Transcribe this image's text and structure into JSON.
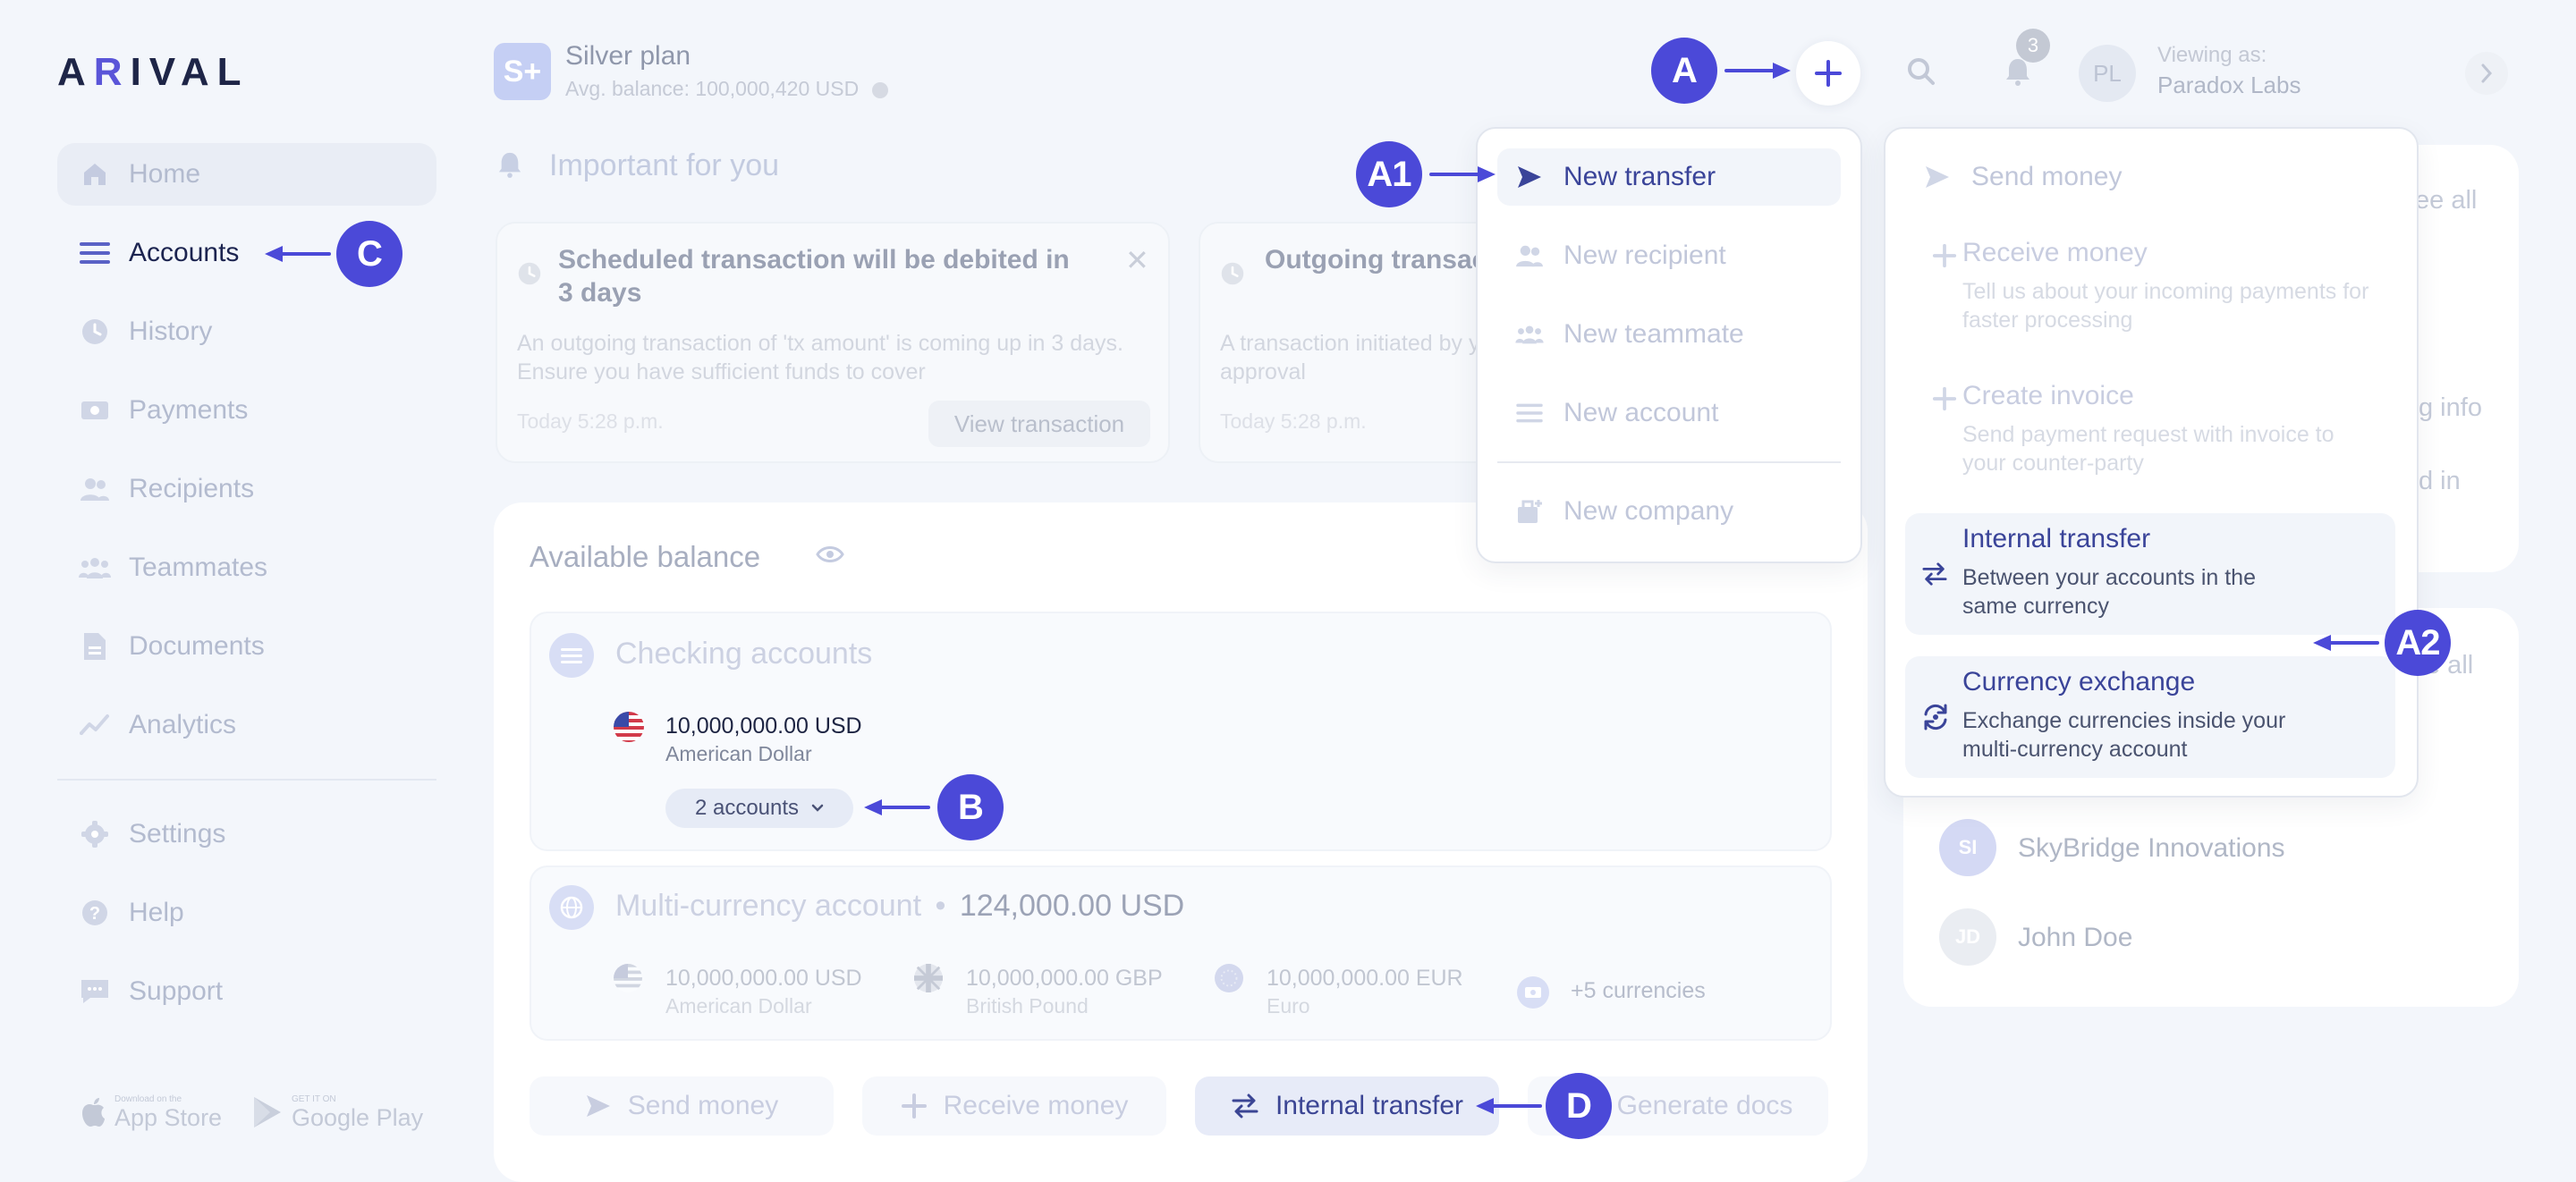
{
  "brand": {
    "logo_text": "ARIVAL"
  },
  "sidebar": {
    "items": [
      {
        "label": "Home",
        "icon": "home-icon"
      },
      {
        "label": "Accounts",
        "icon": "accounts-icon"
      },
      {
        "label": "History",
        "icon": "history-icon"
      },
      {
        "label": "Payments",
        "icon": "payments-icon"
      },
      {
        "label": "Recipients",
        "icon": "recipients-icon"
      },
      {
        "label": "Teammates",
        "icon": "teammates-icon"
      },
      {
        "label": "Documents",
        "icon": "documents-icon"
      },
      {
        "label": "Analytics",
        "icon": "analytics-icon"
      },
      {
        "label": "Settings",
        "icon": "gear-icon"
      },
      {
        "label": "Help",
        "icon": "help-icon"
      },
      {
        "label": "Support",
        "icon": "support-icon"
      }
    ],
    "store": {
      "apple_small": "Download on the",
      "apple_big": "App Store",
      "google_small": "GET IT ON",
      "google_big": "Google Play"
    }
  },
  "header": {
    "plan_badge": "S+",
    "plan_name": "Silver plan",
    "plan_balance": "Avg. balance: 100,000,420 USD",
    "notification_count": "3",
    "avatar_initials": "PL",
    "viewing_label": "Viewing as:",
    "viewing_value": "Paradox Labs"
  },
  "important": {
    "title": "Important for you",
    "cards": [
      {
        "title": "Scheduled transaction will be debited in 3 days",
        "body": "An outgoing transaction of 'tx amount' is coming up in 3 days. Ensure you have sufficient funds to cover",
        "time": "Today 5:28 p.m.",
        "button": "View transaction"
      },
      {
        "title": "Outgoing transaction approval",
        "body": "A transaction initiated by your approval",
        "time": "Today 5:28 p.m."
      }
    ]
  },
  "balance": {
    "title": "Available balance",
    "checking": {
      "title": "Checking accounts",
      "amount": "10,000,000.00 USD",
      "currency_name": "American Dollar",
      "accounts_pill": "2 accounts"
    },
    "multi": {
      "title": "Multi-currency account",
      "separator": "•",
      "total": "124,000.00 USD",
      "currencies": [
        {
          "amount": "10,000,000.00 USD",
          "name": "American Dollar"
        },
        {
          "amount": "10,000,000.00 GBP",
          "name": "British Pound"
        },
        {
          "amount": "10,000,000.00 EUR",
          "name": "Euro"
        }
      ],
      "more": "+5 currencies"
    },
    "actions": {
      "send": "Send money",
      "receive": "Receive money",
      "internal": "Internal transfer",
      "docs": "Generate docs"
    }
  },
  "right_panel": {
    "see_all_1": "ee all",
    "see_all_2": "e all",
    "frag_1": "g info",
    "frag_2": "d in",
    "contacts": [
      {
        "initials": "SI",
        "name": "SkyBridge Innovations"
      },
      {
        "initials": "JD",
        "name": "John Doe"
      }
    ]
  },
  "new_menu": {
    "items": [
      {
        "label": "New transfer",
        "icon": "send-icon"
      },
      {
        "label": "New recipient",
        "icon": "recipient-icon"
      },
      {
        "label": "New teammate",
        "icon": "teammate-icon"
      },
      {
        "label": "New account",
        "icon": "account-icon"
      },
      {
        "label": "New company",
        "icon": "company-icon"
      }
    ]
  },
  "transfer_menu": {
    "send": "Send money",
    "receive": {
      "title": "Receive money",
      "desc": "Tell us about your incoming payments for faster processing"
    },
    "invoice": {
      "title": "Create invoice",
      "desc": "Send payment request with invoice to your counter-party"
    },
    "internal": {
      "title": "Internal transfer",
      "desc": "Between your accounts in the same currency"
    },
    "exchange": {
      "title": "Currency exchange",
      "desc": "Exchange currencies inside your multi-currency account"
    }
  },
  "markers": {
    "a": "A",
    "a1": "A1",
    "a2": "A2",
    "b": "B",
    "c": "C",
    "d": "D"
  },
  "colors": {
    "accent": "#4b49d8",
    "text_dark": "#1c2450",
    "muted": "#c1c7da",
    "background": "#f3f6fb"
  }
}
